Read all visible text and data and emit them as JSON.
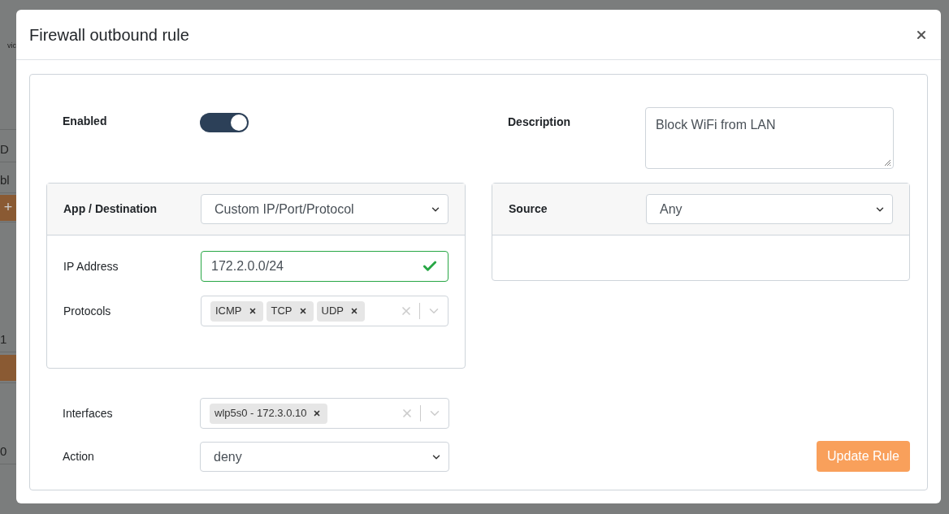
{
  "window": {
    "title": "Firewall outbound rule"
  },
  "background_fragments": [
    {
      "kind": "small",
      "text": "vic"
    },
    {
      "kind": "text",
      "text": "D"
    },
    {
      "kind": "text",
      "text": "bl"
    },
    {
      "kind": "button",
      "text": "+"
    },
    {
      "kind": "text",
      "text": "1"
    },
    {
      "kind": "button"
    },
    {
      "kind": "text",
      "text": "0"
    }
  ],
  "enabled": {
    "label": "Enabled",
    "on": true
  },
  "description": {
    "label": "Description",
    "value": "Block WiFi from LAN"
  },
  "destination": {
    "label": "App / Destination",
    "value": "Custom IP/Port/Protocol",
    "ip": {
      "label": "IP Address",
      "value": "172.2.0.0/24",
      "valid": true
    },
    "protocols": {
      "label": "Protocols",
      "tags": [
        "ICMP",
        "TCP",
        "UDP"
      ]
    }
  },
  "source": {
    "label": "Source",
    "value": "Any"
  },
  "interfaces": {
    "label": "Interfaces",
    "tags": [
      "wlp5s0 - 172.3.0.10"
    ]
  },
  "action": {
    "label": "Action",
    "value": "deny"
  },
  "submit": "Update Rule"
}
